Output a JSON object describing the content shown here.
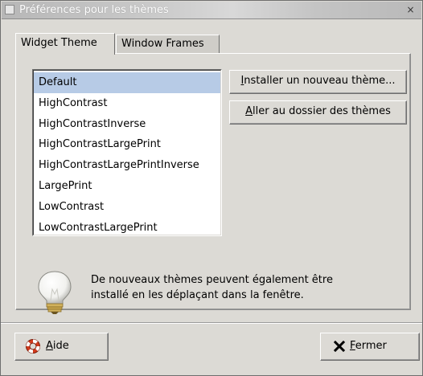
{
  "window": {
    "title": "Préférences pour les thèmes",
    "close_glyph": "×"
  },
  "tabs": [
    {
      "label": "Widget Theme",
      "active": true
    },
    {
      "label": "Window Frames",
      "active": false
    }
  ],
  "themes": {
    "selected": "Default",
    "items": [
      "Default",
      "HighContrast",
      "HighContrastInverse",
      "HighContrastLargePrint",
      "HighContrastLargePrintInverse",
      "LargePrint",
      "LowContrast",
      "LowContrastLargePrint"
    ]
  },
  "actions": {
    "install_prefix": "I",
    "install_rest": "nstaller un nouveau thème...",
    "goto_prefix": "A",
    "goto_rest": "ller au dossier des thèmes"
  },
  "hint": {
    "line1": "De nouveaux thèmes peuvent également être",
    "line2": "installé en les déplaçant dans la fenêtre.",
    "icon": "lightbulb-icon"
  },
  "footer": {
    "help_mnemonic": "A",
    "help_rest": "ide",
    "help_icon": "lifebuoy-icon",
    "close_mnemonic": "F",
    "close_rest": "ermer",
    "close_icon": "close-x-icon"
  },
  "colors": {
    "selection": "#b7cbe6",
    "window_bg": "#dcdad5",
    "lifebuoy_red": "#d23a1c"
  }
}
